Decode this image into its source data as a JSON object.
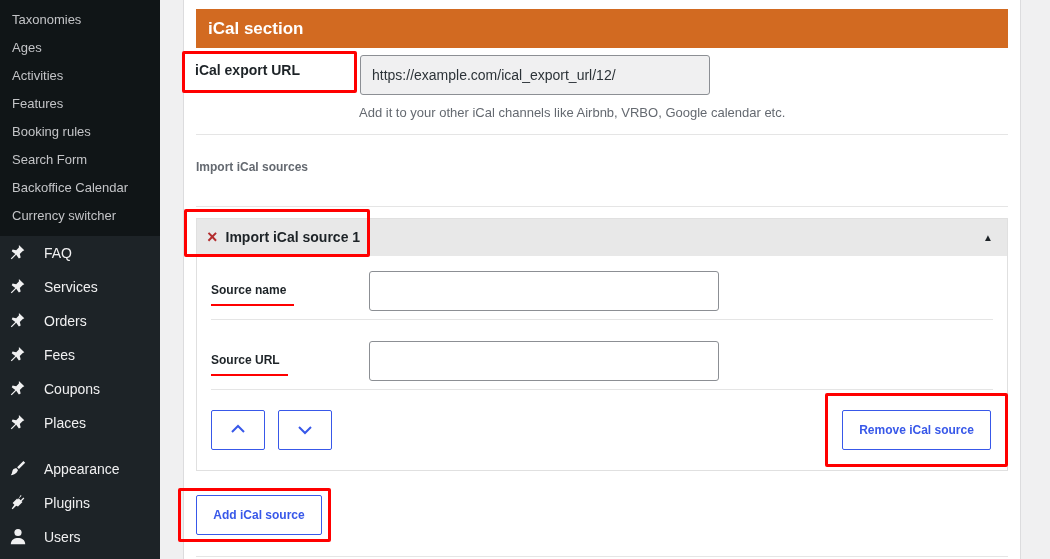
{
  "sidebar": {
    "submenu": [
      "Taxonomies",
      "Ages",
      "Activities",
      "Features",
      "Booking rules",
      "Search Form",
      "Backoffice Calendar",
      "Currency switcher"
    ],
    "menu_groups": [
      [
        {
          "label": "FAQ",
          "kind": "pin"
        },
        {
          "label": "Services",
          "kind": "pin"
        },
        {
          "label": "Orders",
          "kind": "pin"
        },
        {
          "label": "Fees",
          "kind": "pin"
        },
        {
          "label": "Coupons",
          "kind": "pin"
        },
        {
          "label": "Places",
          "kind": "pin"
        }
      ],
      [
        {
          "label": "Appearance",
          "kind": "brush"
        },
        {
          "label": "Plugins",
          "kind": "plug"
        },
        {
          "label": "Users",
          "kind": "user"
        }
      ]
    ]
  },
  "section": {
    "title": "iCal section",
    "export": {
      "label": "iCal export URL",
      "highlighted": true,
      "value": "https://example.com/ical_export_url/12/",
      "description": "Add it to your other iCal channels like Airbnb, VRBO, Google calendar etc."
    },
    "import_heading": "Import iCal sources",
    "sources": [
      {
        "title": "Import iCal source 1",
        "highlighted": true,
        "expanded": true,
        "remove_icon": "×",
        "toggle_icon": "▲",
        "fields": [
          {
            "label": "Source name",
            "underlined": true
          },
          {
            "label": "Source URL",
            "underlined": true
          }
        ],
        "remove_button": {
          "label": "Remove iCal source",
          "highlighted": true
        }
      }
    ],
    "add_button": {
      "label": "Add iCal source",
      "highlighted": true
    }
  }
}
